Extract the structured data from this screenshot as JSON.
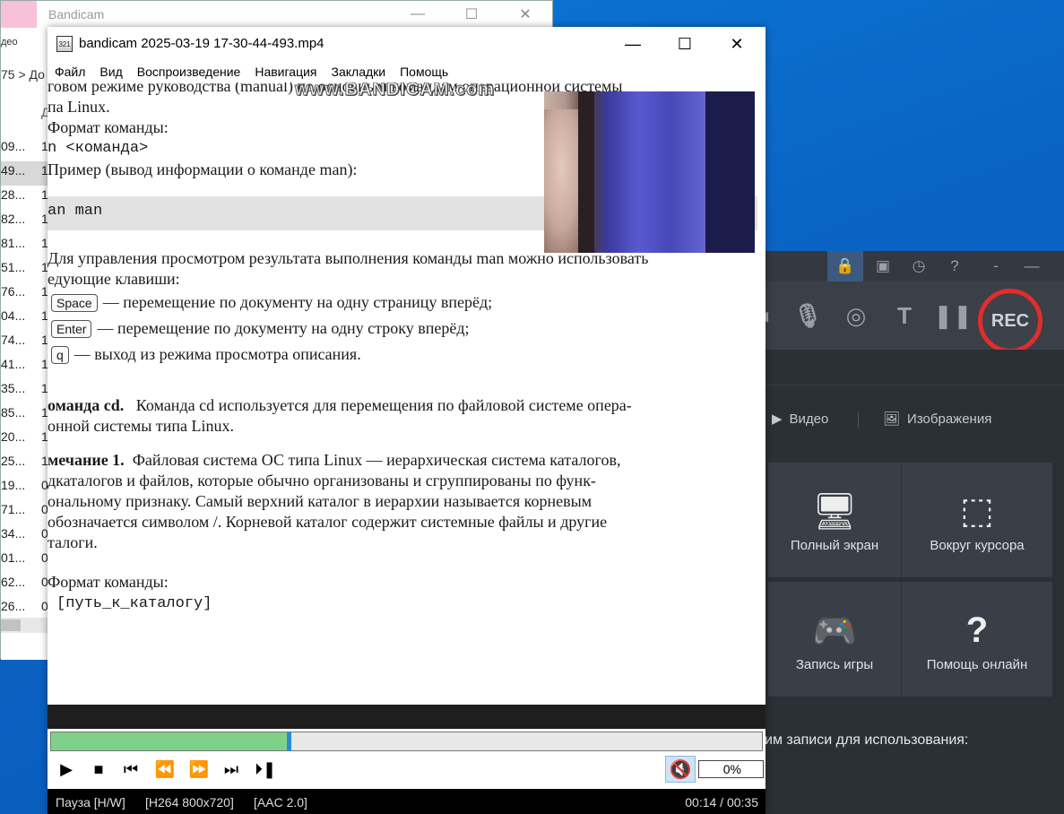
{
  "explorer": {
    "title": "Bandicam",
    "side_label": "део",
    "breadcrumb": "75 > До",
    "col_header": "Д",
    "rows": [
      {
        "a": "09...",
        "b": "1"
      },
      {
        "a": "49...",
        "b": "1"
      },
      {
        "a": "28...",
        "b": "1"
      },
      {
        "a": "82...",
        "b": "1"
      },
      {
        "a": "81...",
        "b": "1"
      },
      {
        "a": "51...",
        "b": "1"
      },
      {
        "a": "76...",
        "b": "1"
      },
      {
        "a": "04...",
        "b": "1"
      },
      {
        "a": "74...",
        "b": "1"
      },
      {
        "a": "41...",
        "b": "1"
      },
      {
        "a": "35...",
        "b": "1"
      },
      {
        "a": "85...",
        "b": "1"
      },
      {
        "a": "20...",
        "b": "1"
      },
      {
        "a": "25...",
        "b": "1"
      },
      {
        "a": "19...",
        "b": "0"
      },
      {
        "a": "71...",
        "b": "0"
      },
      {
        "a": "34...",
        "b": "0"
      },
      {
        "a": "01...",
        "b": "0"
      },
      {
        "a": "62...",
        "b": "0"
      },
      {
        "a": "26...",
        "b": "0"
      }
    ]
  },
  "bandicam": {
    "rec_label": "REC",
    "tab_video": "Видео",
    "tab_images": "Изображения",
    "tiles": [
      {
        "label": "Полный экран",
        "icon": "monitor-icon"
      },
      {
        "label": "Вокруг курсора",
        "icon": "cursor-area-icon"
      },
      {
        "label": "Запись игры",
        "icon": "gamepad-icon"
      },
      {
        "label": "Помощь онлайн",
        "icon": "help-icon"
      }
    ],
    "hint": "им записи для использования:"
  },
  "player": {
    "title": "bandicam 2025-03-19 17-30-44-493.mp4",
    "menu": [
      "Файл",
      "Вид",
      "Воспроизведение",
      "Навигация",
      "Закладки",
      "Помощь"
    ],
    "progress": 0.42,
    "volume": "0%",
    "status_state": "Пауза [H/W]",
    "status_video": "[H264 800x720]",
    "status_audio": "[AAC 2.0]",
    "time": "00:14 / 00:35"
  },
  "video": {
    "watermark": "www.BANDICAM.com",
    "line1": "говом режиме руководства (manual) по основным командам операционной системы",
    "line2": "па Linux.",
    "line3": "Формат команды:",
    "line4": "n <команда>",
    "line5": "Пример (вывод информации о команде man):",
    "code": "an man",
    "line6": "Для управления просмотром результата выполнения команды man можно использовать",
    "line7": "едующие клавиши:",
    "key_space": "Space",
    "key_space_text": "— перемещение по документу на одну страницу вперёд;",
    "key_enter": "Enter",
    "key_enter_text": "— перемещение по документу на одну строку вперёд;",
    "key_q": "q",
    "key_q_text": "— выход из режима просмотра описания.",
    "cd_bold": "оманда cd.",
    "cd_text": "Команда cd используется для перемещения по файловой системе опера-",
    "cd_text2": "онной системы типа Linux.",
    "note_bold": "мечание 1.",
    "note1": "Файловая система ОС типа Linux — иерархическая система каталогов,",
    "note2": "дкаталогов и файлов, которые обычно организованы и сгруппированы по функ-",
    "note3": "ональному признаку. Самый верхний каталог в иерархии называется корневым",
    "note4": "обозначается символом /. Корневой каталог содержит системные файлы и другие",
    "note5": "талоги.",
    "fmt": "Формат команды:",
    "fmt_code": "[путь_к_каталогу]"
  }
}
